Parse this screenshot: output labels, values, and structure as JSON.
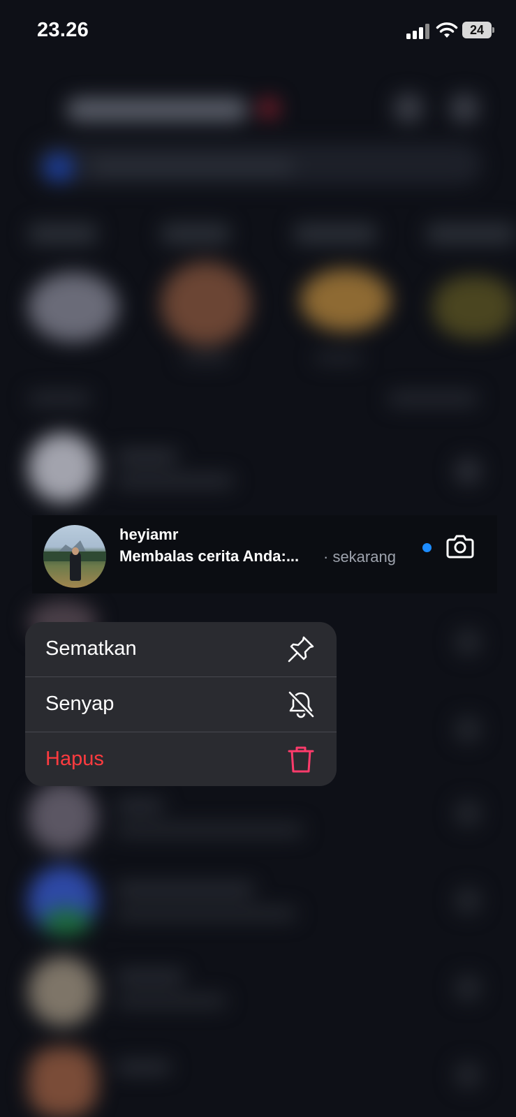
{
  "status_bar": {
    "time": "23.26",
    "battery": "24"
  },
  "thread": {
    "username": "heyiamr",
    "preview": "Membalas cerita Anda:...",
    "timestamp": "· sekarang",
    "unread_color": "#1d8cff"
  },
  "menu": {
    "items": [
      {
        "label": "Sematkan",
        "icon": "pin-icon"
      },
      {
        "label": "Senyap",
        "icon": "bell-off-icon"
      },
      {
        "label": "Hapus",
        "icon": "trash-icon",
        "color": "#ff3b3f"
      }
    ]
  }
}
